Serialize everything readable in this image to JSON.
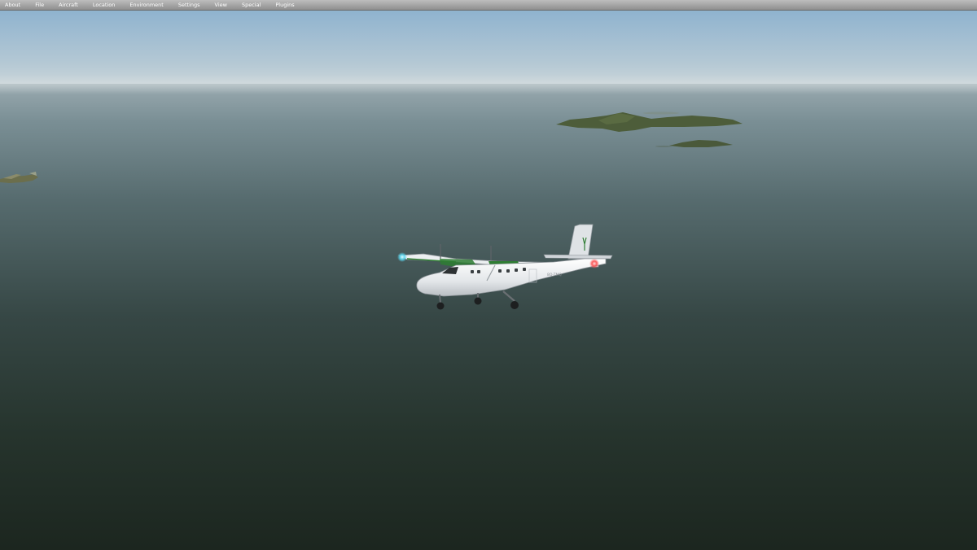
{
  "app": {
    "menu": {
      "items": [
        "About",
        "File",
        "Aircraft",
        "Location",
        "Environment",
        "Settings",
        "View",
        "Special",
        "Plugins"
      ]
    }
  },
  "scene": {
    "icons": {
      "aircraft": "twin-otter-aircraft-icon",
      "islands": "island-icon",
      "other_aircraft": "distant-aircraft-icon"
    },
    "colors": {
      "sky_top": "#8fb3cf",
      "horizon": "#c8d3d8",
      "sea_far": "#6f878e",
      "sea_mid": "#3c4f4f",
      "sea_near": "#1e2a23",
      "island": "#4f5e3d",
      "aircraft_body": "#e9ecef",
      "aircraft_accent": "#2e7d32"
    }
  }
}
